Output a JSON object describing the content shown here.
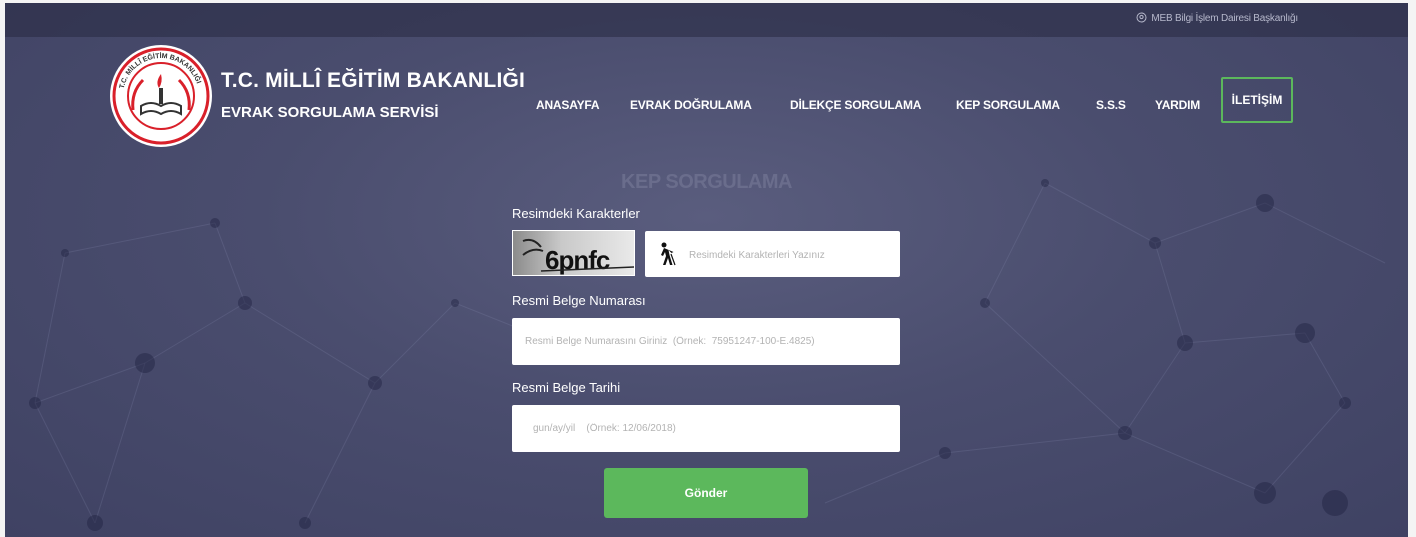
{
  "topbar": {
    "link_text": "MEB Bilgi İşlem Dairesi Başkanlığı",
    "icon": "location-pin-icon"
  },
  "brand": {
    "title": "T.C. MİLLÎ EĞİTİM BAKANLIĞI",
    "subtitle": "EVRAK SORGULAMA SERVİSİ",
    "logo_text": "T.C. MİLLÎ EĞİTİM BAKANLIĞI"
  },
  "nav": {
    "items": [
      {
        "label": "ANASAYFA"
      },
      {
        "label": "EVRAK DOĞRULAMA"
      },
      {
        "label": "DİLEKÇE SORGULAMA"
      },
      {
        "label": "KEP SORGULAMA"
      },
      {
        "label": "S.S.S"
      },
      {
        "label": "YARDIM"
      }
    ],
    "contact_label": "İLETİŞİM"
  },
  "form": {
    "heading": "KEP SORGULAMA",
    "captcha_label": "Resimdeki Karakterler",
    "captcha_text": "6pnfc",
    "captcha_placeholder": "Resimdeki Karakterleri Yazınız",
    "doc_number_label": "Resmi Belge Numarası",
    "doc_number_placeholder": "Resmi Belge Numarasını Giriniz  (Örnek:  75951247-100-E.4825)",
    "doc_date_label": "Resmi Belge Tarihi",
    "doc_date_placeholder": "gun/ay/yil    (Örnek: 12/06/2018)",
    "submit_label": "Gönder"
  },
  "colors": {
    "background": "#4a4d6e",
    "accent_green": "#5cb85c",
    "logo_red": "#d9202a",
    "heading_muted": "#6a6d8c"
  }
}
